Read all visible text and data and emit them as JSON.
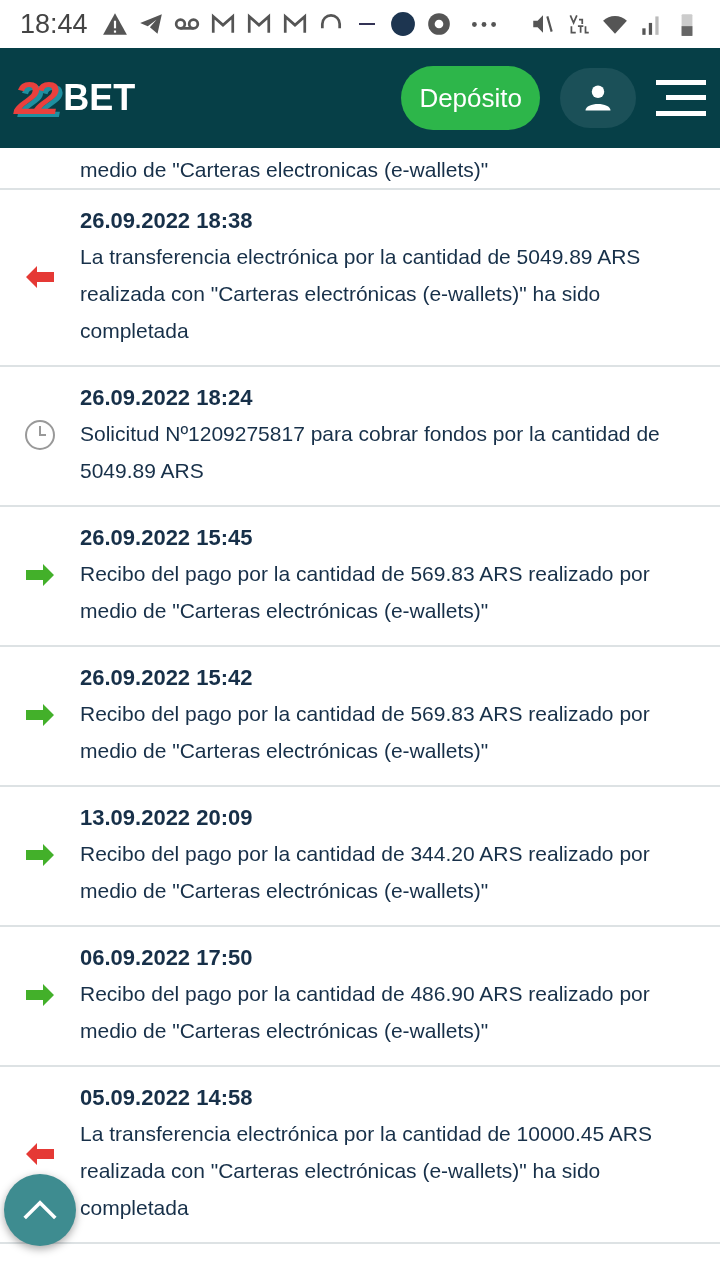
{
  "status_bar": {
    "time": "18:44"
  },
  "header": {
    "logo_digits": "22",
    "logo_word": "BET",
    "deposit_button": "Depósito"
  },
  "clipped_text": "medio de \"Carteras electronicas (e-wallets)\"",
  "transactions": [
    {
      "kind": "out",
      "date": "26.09.2022 18:38",
      "text": "La transferencia electrónica por la cantidad de 5049.89 ARS realizada con \"Carteras electrónicas (e-wallets)\" ha sido completada"
    },
    {
      "kind": "pending",
      "date": "26.09.2022 18:24",
      "text": "Solicitud Nº1209275817 para cobrar fondos por la cantidad de 5049.89 ARS"
    },
    {
      "kind": "in",
      "date": "26.09.2022 15:45",
      "text": "Recibo del pago por la cantidad de 569.83 ARS realizado por medio de \"Carteras electrónicas (e-wallets)\""
    },
    {
      "kind": "in",
      "date": "26.09.2022 15:42",
      "text": "Recibo del pago por la cantidad de 569.83 ARS realizado por medio de \"Carteras electrónicas (e-wallets)\""
    },
    {
      "kind": "in",
      "date": "13.09.2022 20:09",
      "text": "Recibo del pago por la cantidad de 344.20 ARS realizado por medio de \"Carteras electrónicas (e-wallets)\""
    },
    {
      "kind": "in",
      "date": "06.09.2022 17:50",
      "text": "Recibo del pago por la cantidad de 486.90 ARS realizado por medio de \"Carteras electrónicas (e-wallets)\""
    },
    {
      "kind": "out",
      "date": "05.09.2022 14:58",
      "text": "La transferencia electrónica por la cantidad de 10000.45 ARS realizada con \"Carteras electrónicas (e-wallets)\" ha sido completada"
    }
  ]
}
